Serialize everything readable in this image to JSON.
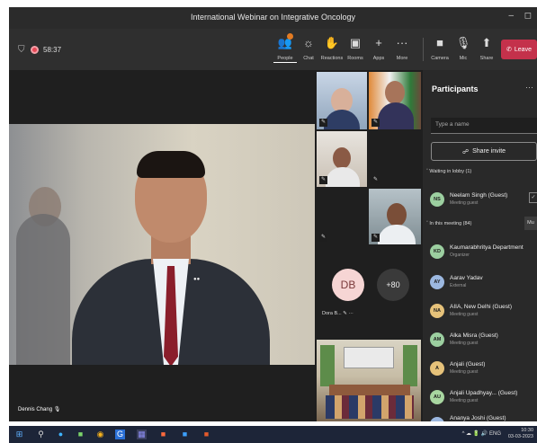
{
  "window": {
    "title": "International Webinar on Integrative Oncology",
    "minimize": "–",
    "restore": "◻"
  },
  "toolbar": {
    "timer": "58:37",
    "buttons": [
      {
        "label": "People",
        "icon": "people-icon",
        "glyph": "👥"
      },
      {
        "label": "Chat",
        "icon": "chat-icon",
        "glyph": "💬"
      },
      {
        "label": "Reactions",
        "icon": "reactions-icon",
        "glyph": "✋"
      },
      {
        "label": "Rooms",
        "icon": "rooms-icon",
        "glyph": "▣"
      },
      {
        "label": "Apps",
        "icon": "apps-icon",
        "glyph": "+"
      },
      {
        "label": "More",
        "icon": "more-icon",
        "glyph": "···"
      },
      {
        "label": "Camera",
        "icon": "camera-icon",
        "glyph": "■"
      },
      {
        "label": "Mic",
        "icon": "mic-icon",
        "glyph": "🎙"
      },
      {
        "label": "Share",
        "icon": "share-icon",
        "glyph": "⬆"
      }
    ],
    "leave_label": "Leave"
  },
  "main_video": {
    "speaker_name": "Dennis Chang"
  },
  "grid": {
    "avatar_initials": "DB",
    "avatar_name": "Dora B...",
    "overflow_count": "+80"
  },
  "participants_panel": {
    "title": "Participants",
    "search_placeholder": "Type a name",
    "share_invite_label": "Share invite",
    "waiting_header": "Waiting in lobby (1)",
    "in_meeting_header": "In this meeting (84)",
    "mute_all_label": "Mu",
    "waiting": [
      {
        "initials": "NS",
        "name": "Neelam Singh (Guest)",
        "role": "Meeting guest",
        "color": "#9ccfa0"
      }
    ],
    "in_meeting": [
      {
        "initials": "KD",
        "name": "Kaumarabhritya Department",
        "role": "Organizer",
        "color": "#9ccfa0"
      },
      {
        "initials": "AY",
        "name": "Aarav Yadav",
        "role": "External",
        "color": "#9cb8e0"
      },
      {
        "initials": "NA",
        "name": "AIIA, New Delhi (Guest)",
        "role": "Meeting guest",
        "color": "#e6c27a"
      },
      {
        "initials": "AM",
        "name": "Alka Misra (Guest)",
        "role": "Meeting guest",
        "color": "#9ccfa0"
      },
      {
        "initials": "A",
        "name": "Anjali (Guest)",
        "role": "Meeting guest",
        "color": "#e6c27a"
      },
      {
        "initials": "AU",
        "name": "Anjali Upadhyay... (Guest)",
        "role": "Meeting guest",
        "color": "#a8d6a0"
      },
      {
        "initials": "",
        "name": "Ananya Joshi (Guest)",
        "role": "",
        "color": "#9cb8e0"
      }
    ]
  },
  "taskbar": {
    "tray_text": "^ ☁ 🔋 🔊 ENG",
    "time": "10:30",
    "date": "03-03-2023"
  }
}
